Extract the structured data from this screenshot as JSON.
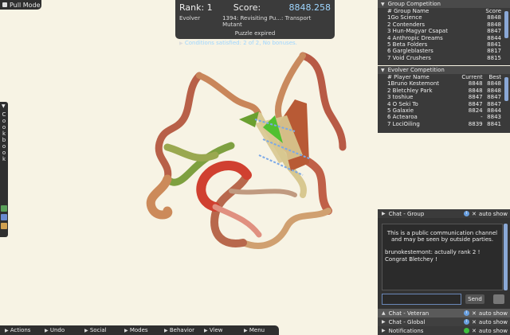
{
  "pull_mode": {
    "label": "Pull Mode"
  },
  "score_panel": {
    "rank_label": "Rank: 1",
    "score_label": "Score:",
    "score_value": "8848.258",
    "evolver": "Evolver",
    "puzzle": "1394: Revisiting Pu...: Transport Mutant",
    "status": "Puzzle expired",
    "conditions": "Conditions satisfied: 2 of 2, No bonuses."
  },
  "group_competition": {
    "title": "Group Competition",
    "headers": [
      "# Group Name",
      "Score"
    ],
    "rows": [
      [
        "1Go Science",
        "8848"
      ],
      [
        "2 Contenders",
        "8848"
      ],
      [
        "3 Hun-Magyar Csapat",
        "8847"
      ],
      [
        "4 Anthropic Dreams",
        "8844"
      ],
      [
        "5 Beta Folders",
        "8841"
      ],
      [
        "6 Gargleblasters",
        "8817"
      ],
      [
        "7 Void Crushers",
        "8815"
      ]
    ]
  },
  "evolver_competition": {
    "title": "Evolver Competition",
    "headers": [
      "# Player Name",
      "Current",
      "Best"
    ],
    "rows": [
      [
        "1Bruno Kestemont",
        "8848",
        "8848"
      ],
      [
        "2 Bletchley Park",
        "8848",
        "8848"
      ],
      [
        "3 toshiue",
        "8847",
        "8847"
      ],
      [
        "4 O Seki To",
        "8847",
        "8847"
      ],
      [
        "5 Galaxie",
        "8824",
        "8844"
      ],
      [
        "6 Actearoa",
        "-",
        "8843"
      ],
      [
        "7 LociOiling",
        "8839",
        "8841"
      ]
    ]
  },
  "chat": {
    "group_title": "Chat - Group",
    "auto_show": "auto show",
    "notice": "This is a public communication channel and may be seen by outside parties.",
    "message_user": "brunokestemont",
    "message_text": ": actually rank 2 ! Congrat Bletchey !",
    "send": "Send",
    "veteran": "Chat - Veteran",
    "global": "Chat - Global",
    "notifications": "Notifications"
  },
  "cookbook": {
    "label": "Cookbook"
  },
  "bottom_menu": [
    "Actions",
    "Undo",
    "Social",
    "Modes",
    "Behavior",
    "View",
    "Menu"
  ]
}
